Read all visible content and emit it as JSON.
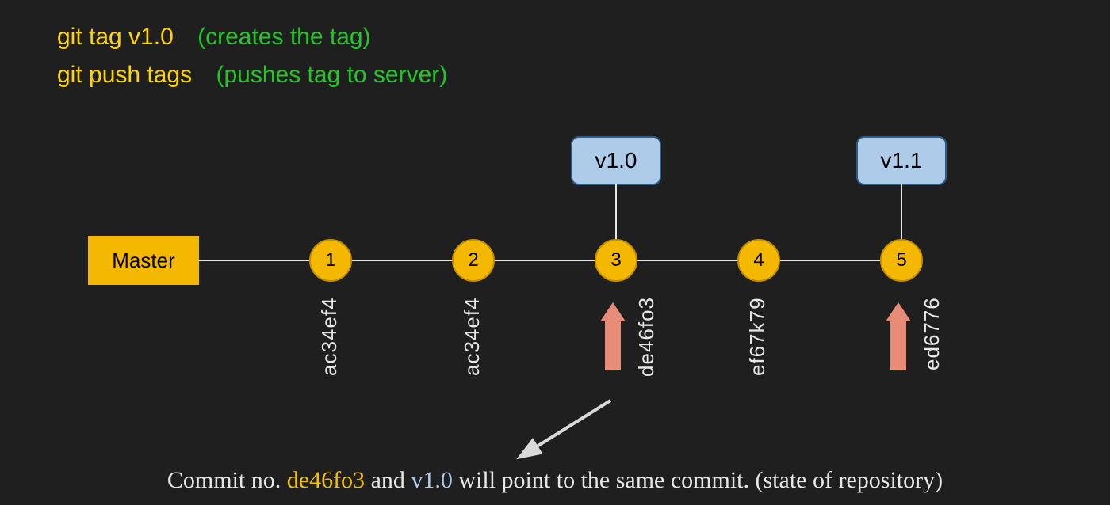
{
  "commands": [
    {
      "cmd": "git tag v1.0",
      "desc": "(creates the tag)"
    },
    {
      "cmd": "git push tags",
      "desc": "(pushes tag to server)"
    }
  ],
  "branch_label": "Master",
  "tags": [
    {
      "label": "v1.0",
      "commit_index": 3
    },
    {
      "label": "v1.1",
      "commit_index": 5
    }
  ],
  "commits": [
    {
      "n": "1",
      "hash": "ac34ef4",
      "has_arrow": false
    },
    {
      "n": "2",
      "hash": "ac34ef4",
      "has_arrow": false
    },
    {
      "n": "3",
      "hash": "de46fo3",
      "has_arrow": true
    },
    {
      "n": "4",
      "hash": "ef67k79",
      "has_arrow": false
    },
    {
      "n": "5",
      "hash": "ed6776",
      "has_arrow": true
    }
  ],
  "footer": {
    "pre": "Commit no. ",
    "hash": "de46fo3",
    "mid": " and ",
    "tag": "v1.0",
    "post": " will point to the same commit. (state of repository)"
  },
  "colors": {
    "bg": "#1f1f1f",
    "yellow": "#f5b800",
    "green": "#22c727",
    "blue": "#aeccea",
    "salmon": "#e78c77",
    "text_light": "#e7e7e7"
  }
}
